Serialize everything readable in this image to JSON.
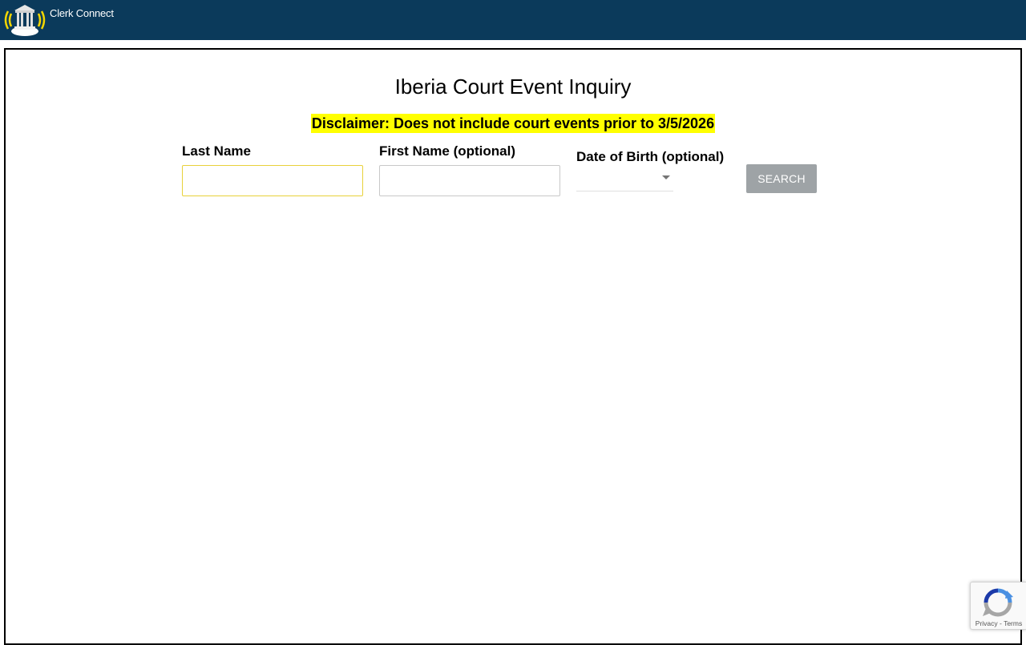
{
  "header": {
    "brand": "Clerk Connect",
    "logo_icon": "courthouse-signal-icon",
    "background": "#0b3a5b"
  },
  "page": {
    "title": "Iberia Court Event Inquiry",
    "disclaimer": "Disclaimer: Does not include court events prior to 3/5/2026",
    "disclaimer_highlight": "#ffff00"
  },
  "form": {
    "last_name_label": "Last Name",
    "last_name_value": "",
    "first_name_label": "First Name (optional)",
    "first_name_value": "",
    "dob_label": "Date of Birth (optional)",
    "dob_value": "",
    "dob_icon": "dropdown-arrow-icon",
    "search_label": "SEARCH"
  },
  "recaptcha": {
    "icon": "recaptcha-icon",
    "privacy": "Privacy",
    "separator": " - ",
    "terms": "Terms"
  }
}
